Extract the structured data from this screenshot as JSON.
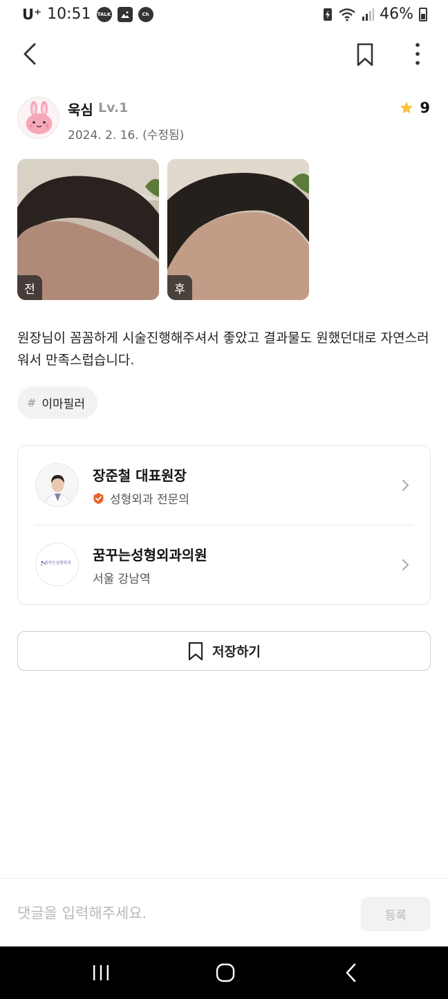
{
  "status_bar": {
    "carrier": "U⁺",
    "time": "10:51",
    "notifications": [
      "talk-icon",
      "gallery-icon",
      "channel-icon"
    ],
    "notification_labels": [
      "TALK",
      "",
      "Ch"
    ],
    "battery": "46%"
  },
  "review": {
    "author": "욱심",
    "level": "Lv.1",
    "date": "2024. 2. 16. (수정됨)",
    "rating": "9",
    "photos": [
      {
        "tag": "전"
      },
      {
        "tag": "후"
      }
    ],
    "text": "원장님이 꼼꼼하게 시술진행해주셔서 좋았고 결과물도 원했던대로 자연스러워서 만족스럽습니다.",
    "hashtag": "이마필러",
    "hashtag_mark": "#"
  },
  "doctor": {
    "name": "장준철 대표원장",
    "specialty": "성형외과 전문의"
  },
  "hospital": {
    "name": "꿈꾸는성형외과의원",
    "location": "서울 강남역",
    "logo_text": "꿈꾸는성형외과"
  },
  "save_button": {
    "label": "저장하기"
  },
  "comment": {
    "placeholder": "댓글을 입력해주세요.",
    "submit_label": "등록"
  },
  "colors": {
    "star": "#f8c33a",
    "badge": "#e8622c",
    "divider": "#e6e6e6"
  }
}
